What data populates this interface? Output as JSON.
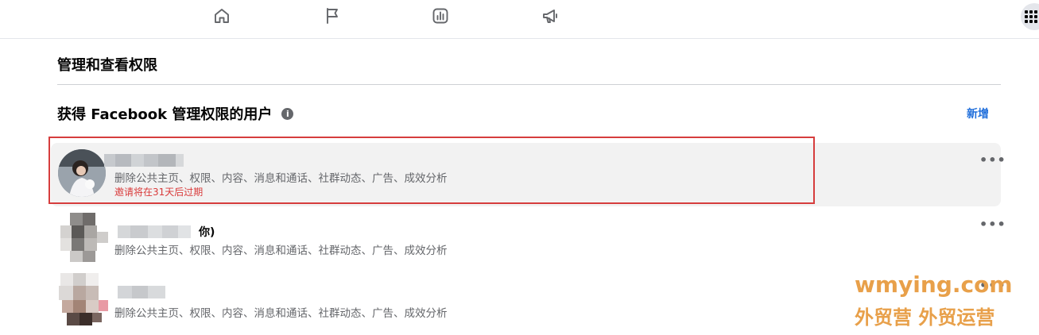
{
  "section": {
    "title": "管理和查看权限",
    "subtitle": "获得 Facebook 管理权限的用户",
    "info_glyph": "i",
    "add_label": "新增"
  },
  "nav": {
    "icons": [
      "home-icon",
      "flag-icon",
      "insights-icon",
      "megaphone-icon"
    ],
    "menu_icon": "grid-menu-icon"
  },
  "users": [
    {
      "name": "",
      "permissions": "删除公共主页、权限、内容、消息和通话、社群动态、广告、成效分析",
      "status": "邀请将在31天后过期",
      "more": "•••",
      "highlighted": true
    },
    {
      "name_suffix": "你)",
      "permissions": "删除公共主页、权限、内容、消息和通话、社群动态、广告、成效分析",
      "more": "•••"
    },
    {
      "permissions": "删除公共主页、权限、内容、消息和通话、社群动态、广告、成效分析",
      "more": "•••"
    }
  ],
  "colors": {
    "accent": "#216fdb",
    "highlight_bg": "#f2f2f2",
    "annotation_red": "#d63d3d",
    "expire_red": "#d93a3a",
    "watermark": "#e8a04a"
  },
  "watermark": {
    "line1": "wmying.com",
    "line2": "外贸营 外贸运营"
  }
}
